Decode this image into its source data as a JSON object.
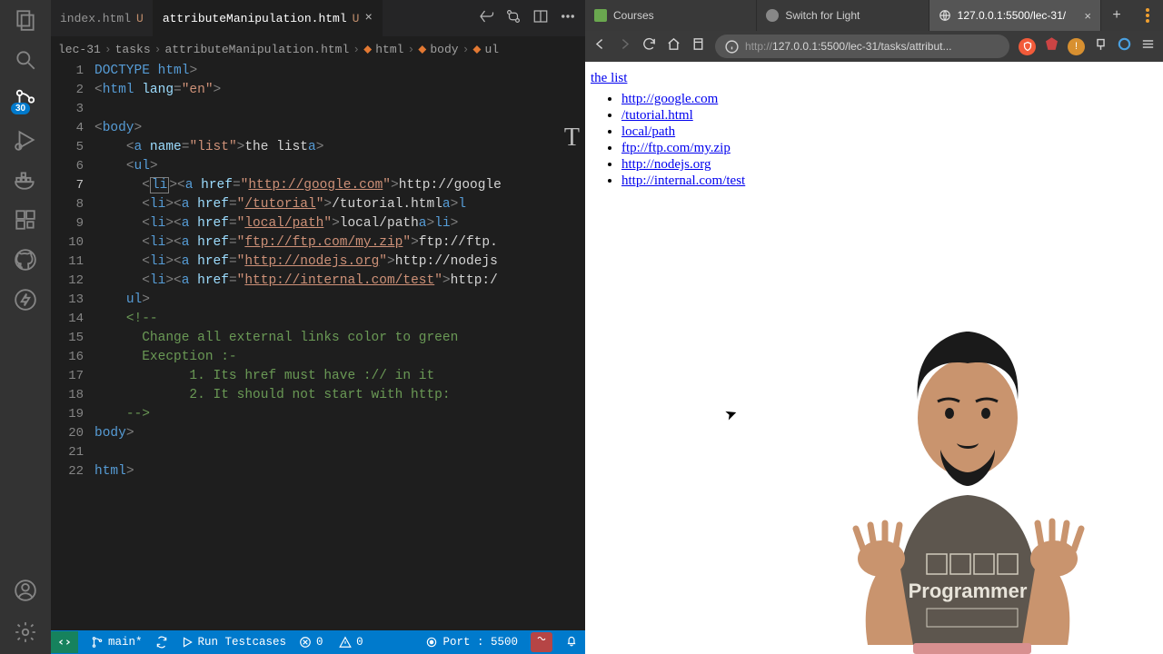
{
  "activity": {
    "scm_badge": "30"
  },
  "tabs": [
    {
      "label": "index.html",
      "dirty": "U",
      "active": false
    },
    {
      "label": "attributeManipulation.html",
      "dirty": "U",
      "active": true
    }
  ],
  "breadcrumb": {
    "folder": "lec-31",
    "sub": "tasks",
    "file": "attributeManipulation.html",
    "path": [
      "html",
      "body",
      "ul"
    ]
  },
  "code": {
    "lines": [
      1,
      2,
      3,
      4,
      5,
      6,
      7,
      8,
      9,
      10,
      11,
      12,
      13,
      14,
      15,
      16,
      17,
      18,
      19,
      20,
      21,
      22
    ],
    "highlighted_line": 7,
    "hrefs": [
      "http://google.com",
      "/tutorial",
      "local/path",
      "ftp://ftp.com/my.zip",
      "http://nodejs.org",
      "http://internal.com/test"
    ],
    "link_texts": [
      "http://google",
      "/tutorial.html",
      "local/path",
      "ftp://ftp.",
      "http://nodejs",
      "http:/"
    ],
    "anchor_name": "list",
    "anchor_text": "the list",
    "comment": [
      "Change all external links color to green",
      "Execption :-",
      "1. Its href must have :// in it",
      "2. It should not start with http:"
    ]
  },
  "statusbar": {
    "branch": "main*",
    "run": "Run Testcases",
    "errors": "0",
    "warnings": "0",
    "port_label": "Port : 5500"
  },
  "browser": {
    "tabs": [
      {
        "label": "Courses"
      },
      {
        "label": "Switch for Light"
      },
      {
        "label": "127.0.0.1:5500/lec-31/"
      }
    ],
    "url_scheme": "http://",
    "url_rest": "127.0.0.1:5500/lec-31/tasks/attribut...",
    "page_title": "the list",
    "links": [
      "http://google.com",
      "/tutorial.html",
      "local/path",
      "ftp://ftp.com/my.zip",
      "http://nodejs.org",
      "http://internal.com/test"
    ]
  },
  "presenter": {
    "shirt_text": "Programmer"
  }
}
